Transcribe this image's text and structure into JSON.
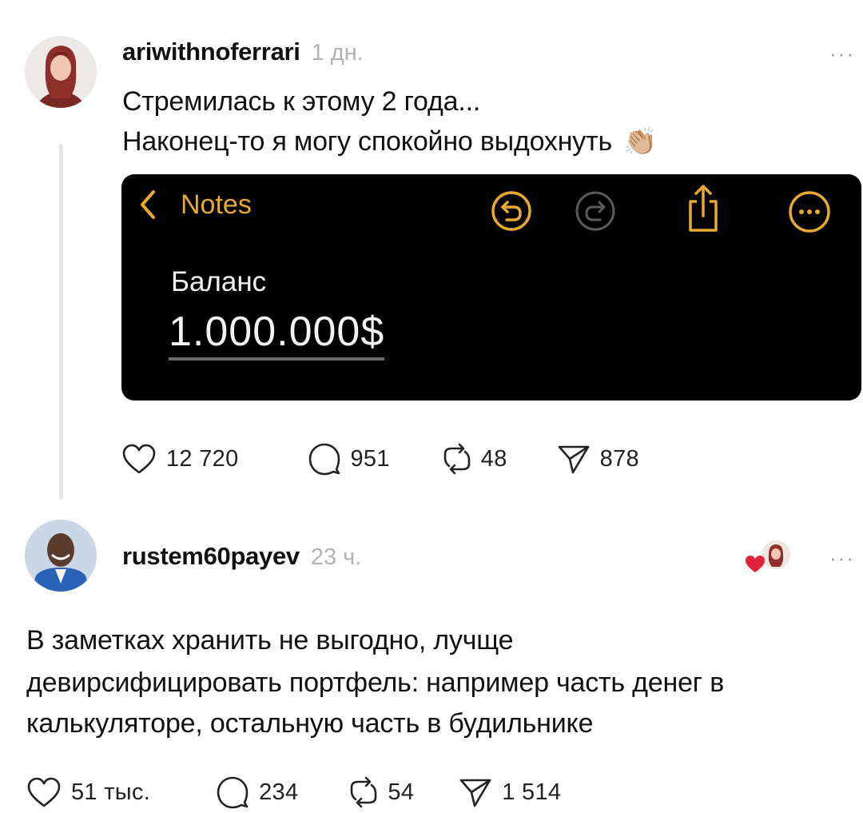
{
  "post1": {
    "username": "ariwithnoferrari",
    "time": "1 дн.",
    "more": "···",
    "text_line1": "Стремилась к этому 2 года...",
    "text_line2": "Наконец-то я могу спокойно выдохнуть",
    "emoji": "👏🏼",
    "image": {
      "back_label": "Notes",
      "balance_label": "Баланс",
      "amount": "1.000.000$",
      "accent_color": "#e8a92f"
    },
    "likes": "12 720",
    "comments": "951",
    "reposts": "48",
    "shares": "878"
  },
  "post2": {
    "username": "rustem60payev",
    "time": "23 ч.",
    "more": "···",
    "text_line1": "В заметках хранить не выгодно, лучще",
    "text_line2": "девирсифицировать портфель: например часть денег в",
    "text_line3": "калькуляторе, остальную часть в будильнике",
    "likes": "51 тыс.",
    "comments": "234",
    "reposts": "54",
    "shares": "1 514"
  },
  "icons": {
    "heart": "heart-icon",
    "comment": "comment-icon",
    "repost": "repost-icon",
    "share": "share-icon",
    "undo": "undo-icon",
    "redo": "redo-icon",
    "export": "share-export-icon",
    "more": "more-circle-icon",
    "back": "chevron-left-icon"
  },
  "colors": {
    "text": "#111111",
    "muted": "#b3b3b3",
    "liked_heart": "#e0223b"
  }
}
